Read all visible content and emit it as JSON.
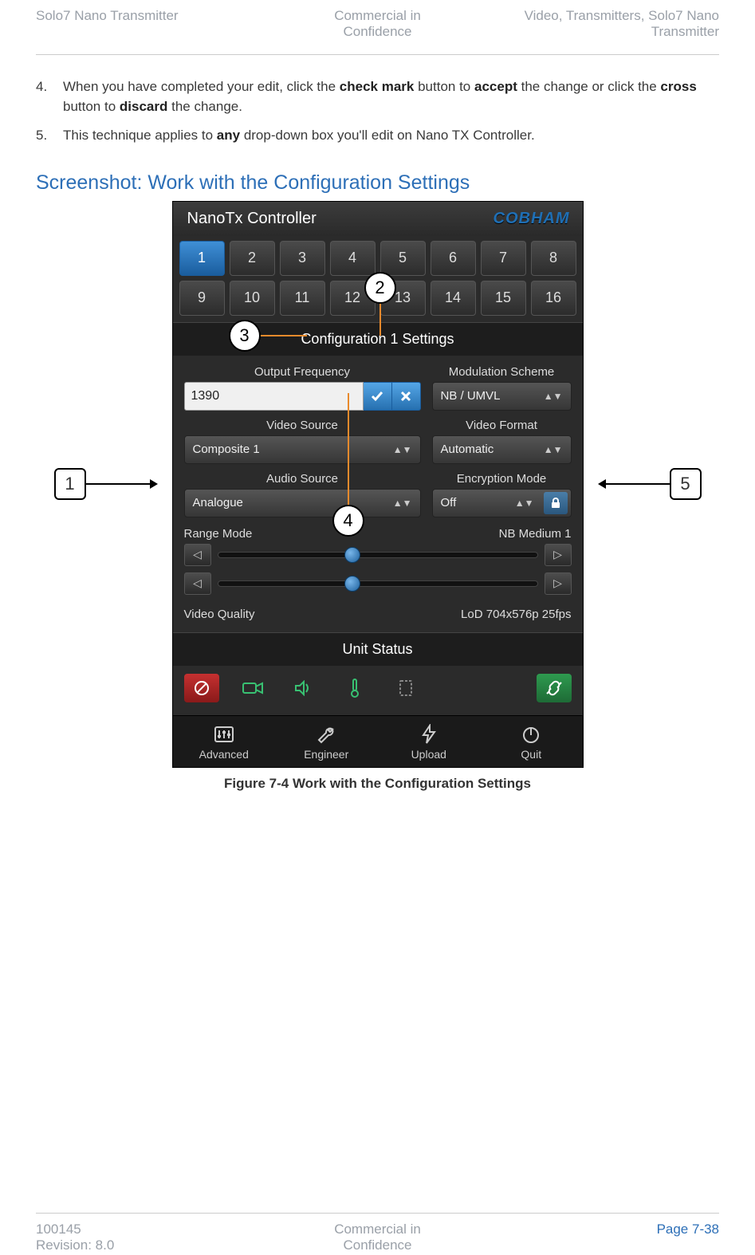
{
  "header": {
    "left": "Solo7 Nano Transmitter",
    "center_l1": "Commercial in",
    "center_l2": "Confidence",
    "right_l1": "Video, Transmitters, Solo7 Nano",
    "right_l2": "Transmitter"
  },
  "steps": {
    "s4_num": "4.",
    "s4_a": "When you have completed your edit, click the ",
    "s4_b": "check mark",
    "s4_c": " button to ",
    "s4_d": "accept",
    "s4_e": " the change or click the ",
    "s4_f": "cross",
    "s4_g": " button to ",
    "s4_h": "discard",
    "s4_i": " the change.",
    "s5_num": "5.",
    "s5_a": "This technique applies to ",
    "s5_b": "any",
    "s5_c": " drop-down box you'll edit on Nano TX Controller."
  },
  "section_heading": "Screenshot: Work with the Configuration Settings",
  "callouts": {
    "c1": "1",
    "c2": "2",
    "c3": "3",
    "c4": "4",
    "c5": "5"
  },
  "app": {
    "title": "NanoTx Controller",
    "brand": "COBHAM",
    "presets": [
      "1",
      "2",
      "3",
      "4",
      "5",
      "6",
      "7",
      "8",
      "9",
      "10",
      "11",
      "12",
      "13",
      "14",
      "15",
      "16"
    ],
    "selected_preset_index": 0,
    "config_title": "Configuration 1 Settings",
    "fields": {
      "output_freq_label": "Output Frequency",
      "output_freq_value": "1390",
      "mod_scheme_label": "Modulation Scheme",
      "mod_scheme_value": "NB / UMVL",
      "video_source_label": "Video Source",
      "video_source_value": "Composite 1",
      "video_format_label": "Video Format",
      "video_format_value": "Automatic",
      "audio_source_label": "Audio Source",
      "audio_source_value": "Analogue",
      "encryption_label": "Encryption Mode",
      "encryption_value": "Off"
    },
    "range_label": "Range Mode",
    "range_value": "NB Medium 1",
    "vq_label": "Video Quality",
    "vq_value": "LoD 704x576p 25fps",
    "unit_status": "Unit Status",
    "nav": {
      "advanced": "Advanced",
      "engineer": "Engineer",
      "upload": "Upload",
      "quit": "Quit"
    }
  },
  "figure_caption": "Figure 7-4 Work with the Configuration Settings",
  "footer": {
    "left_l1": "100145",
    "left_l2": "Revision: 8.0",
    "center_l1": "Commercial in",
    "center_l2": "Confidence",
    "right": "Page 7-38"
  }
}
